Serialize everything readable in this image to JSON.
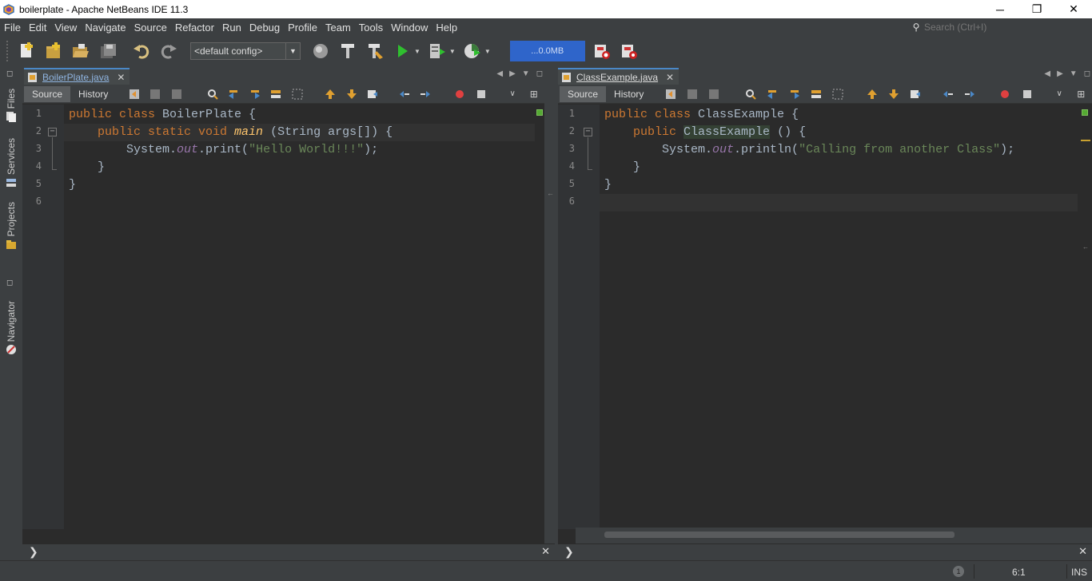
{
  "window": {
    "title": "boilerplate - Apache NetBeans IDE 11.3",
    "minimize": "─",
    "maximize": "❐",
    "close": "✕"
  },
  "menu": [
    "File",
    "Edit",
    "View",
    "Navigate",
    "Source",
    "Refactor",
    "Run",
    "Debug",
    "Profile",
    "Team",
    "Tools",
    "Window",
    "Help"
  ],
  "search": {
    "placeholder": "Search (Ctrl+I)"
  },
  "toolbar": {
    "config": "<default config>",
    "memory": "...0.0MB",
    "icons": [
      "new-file-icon",
      "new-project-icon",
      "open-project-icon",
      "save-all-icon",
      "undo-icon",
      "redo-icon",
      "globe-icon",
      "build-hammer-icon",
      "clean-build-icon",
      "run-icon",
      "debug-icon",
      "profile-icon",
      "gc-icon",
      "gc-snapshot-icon"
    ]
  },
  "sidebar": {
    "files": "Files",
    "services": "Services",
    "projects": "Projects",
    "navigator": "Navigator"
  },
  "editors": [
    {
      "tab": "BoilerPlate.java",
      "source": "Source",
      "history": "History",
      "lines": [
        "1",
        "2",
        "3",
        "4",
        "5",
        "6"
      ],
      "code": {
        "l1_kw": "public class ",
        "l1_name": "BoilerPlate {",
        "l2_kw": "public static void ",
        "l2_fn": "main",
        "l2_rest": " (String args[]) {",
        "l3_a": "System.",
        "l3_fld": "out",
        "l3_b": ".print(",
        "l3_str": "\"Hello World!!!\"",
        "l3_c": ");",
        "l4": "}",
        "l5": "}"
      }
    },
    {
      "tab": "ClassExample.java",
      "source": "Source",
      "history": "History",
      "lines": [
        "1",
        "2",
        "3",
        "4",
        "5",
        "6"
      ],
      "code": {
        "l1_kw": "public class ",
        "l1_name": "ClassExample {",
        "l2_kw": "public ",
        "l2_ctor": "ClassExample",
        "l2_rest": " () {",
        "l3_a": "System.",
        "l3_fld": "out",
        "l3_b": ".println(",
        "l3_str": "\"Calling from another Class\"",
        "l3_c": ");",
        "l4": "}",
        "l5": "}"
      }
    }
  ],
  "status": {
    "notifications": "1",
    "position": "6:1",
    "mode": "INS"
  },
  "colors": {
    "background": "#3c3f41",
    "editor": "#2b2b2b",
    "keyword": "#cc7832",
    "string": "#6a8759",
    "method": "#ffc66d",
    "field": "#9876aa",
    "memory_bar": "#2f65ca"
  }
}
